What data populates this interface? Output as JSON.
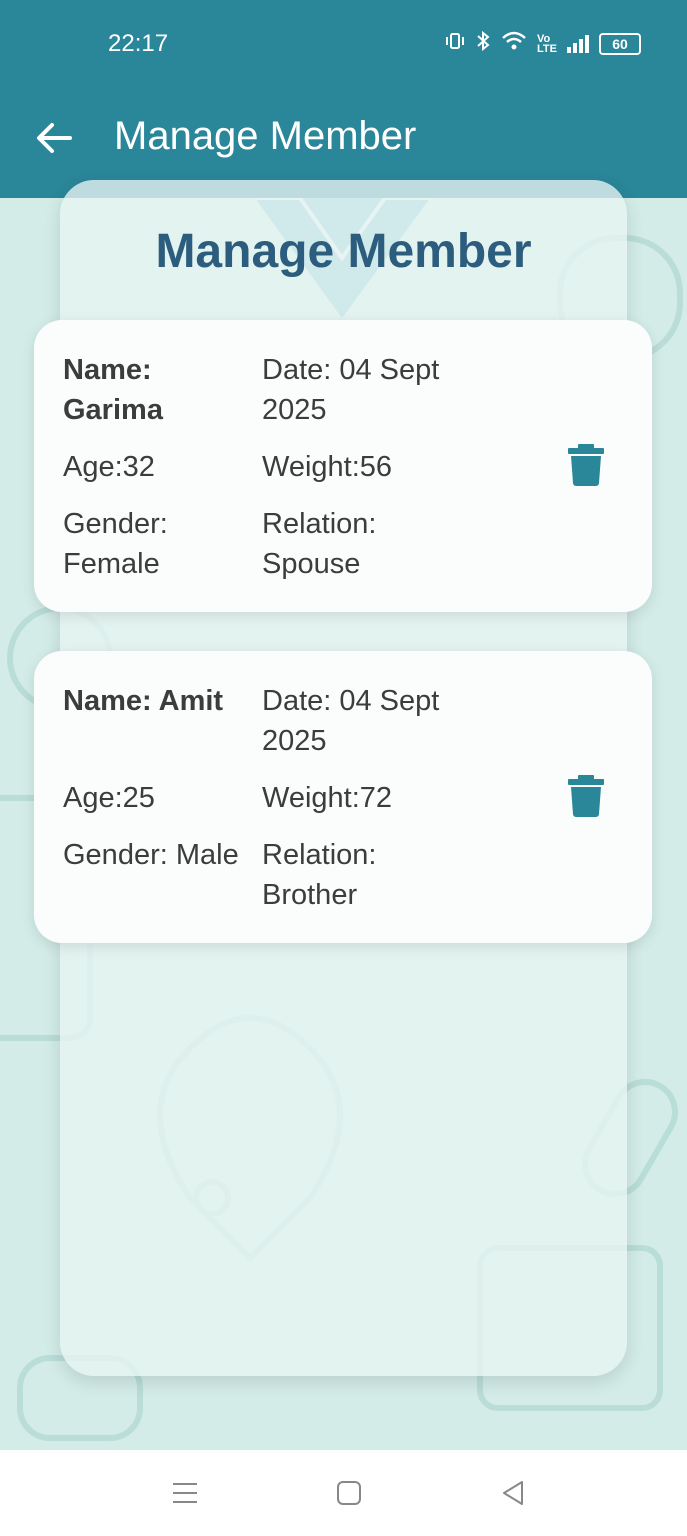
{
  "status_bar": {
    "time": "22:17",
    "battery": "60",
    "icons": [
      "vibrate-icon",
      "bluetooth-icon",
      "wifi-icon",
      "volte-icon",
      "signal-icon",
      "battery-icon"
    ]
  },
  "app_bar": {
    "title": "Manage Member",
    "back_icon": "arrow-left-icon"
  },
  "page": {
    "title": "Manage Member"
  },
  "members": [
    {
      "name_line1": "Name:",
      "name_line2": "Garima",
      "date_line1": "Date: 04 Sept",
      "date_line2": "2025",
      "age": "Age:32",
      "weight": "Weight:56",
      "gender_line1": "Gender:",
      "gender_line2": "Female",
      "relation_line1": "Relation:",
      "relation_line2": "Spouse"
    },
    {
      "name_line1": "Name: Amit",
      "name_line2": "",
      "date_line1": "Date: 04 Sept",
      "date_line2": "2025",
      "age": "Age:25",
      "weight": "Weight:72",
      "gender_line1": "Gender: Male",
      "gender_line2": "",
      "relation_line1": "Relation:",
      "relation_line2": "Brother"
    }
  ],
  "colors": {
    "primary": "#2a8699",
    "title_text": "#2d5d7e",
    "background": "#d3ece8"
  }
}
